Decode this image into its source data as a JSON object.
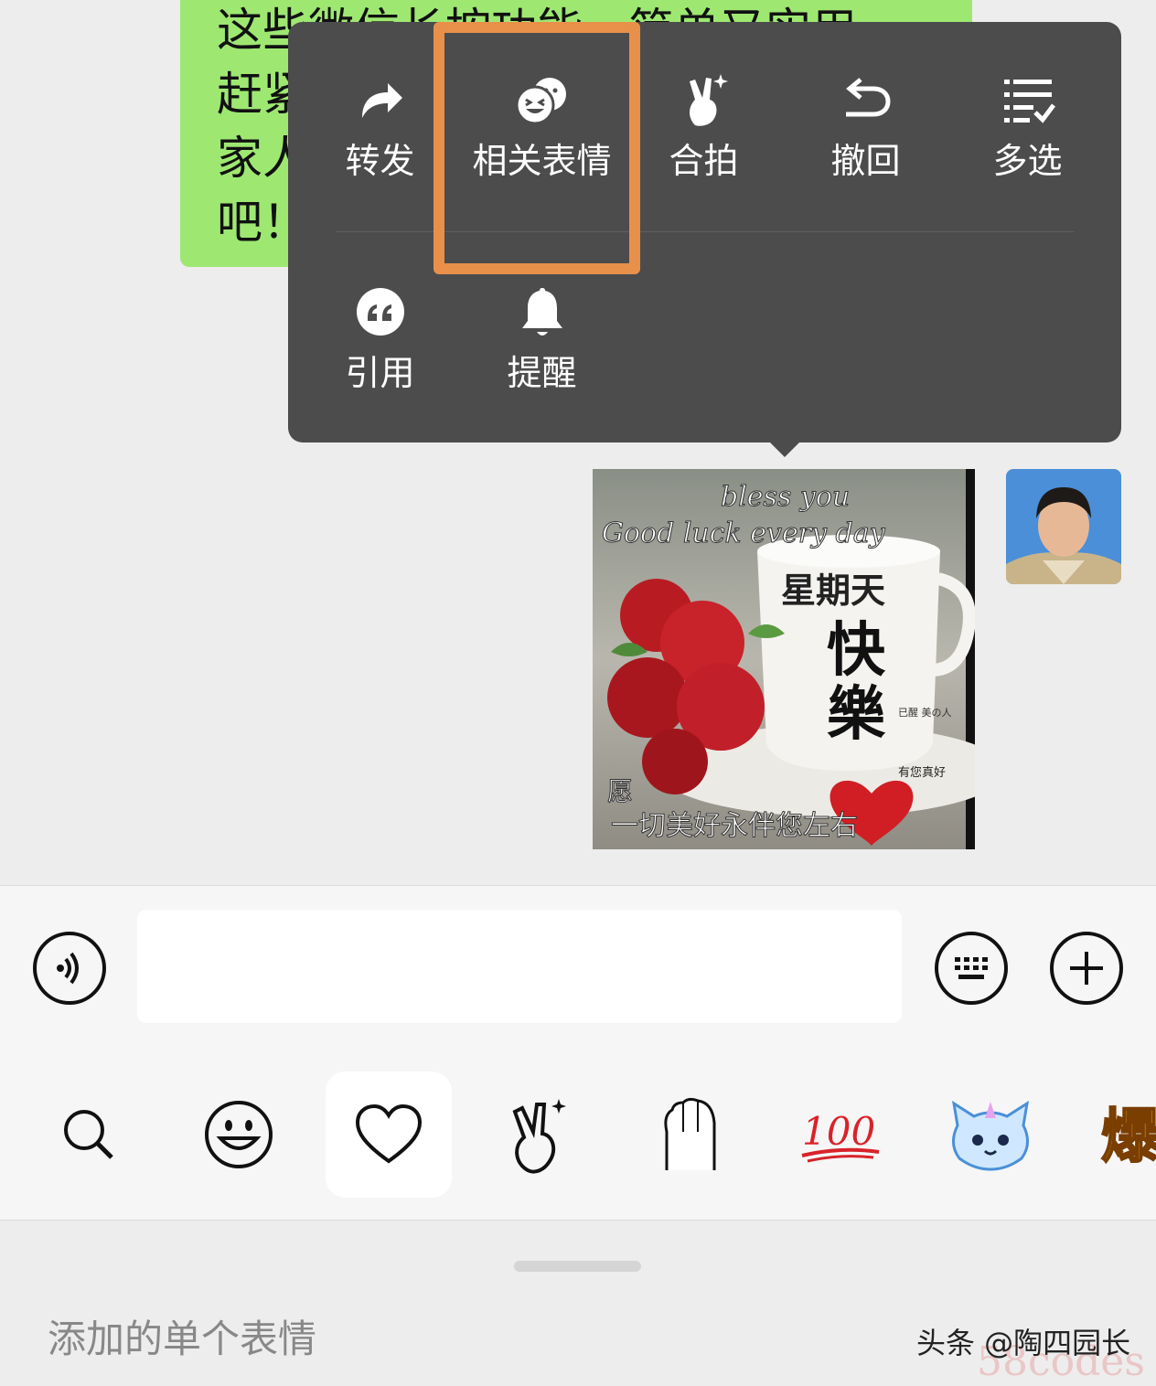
{
  "chat": {
    "message_text": "这些微信长按功能，简单又实用，赶紧\n家人\n吧！"
  },
  "context_menu": {
    "row1": [
      {
        "label": "转发",
        "icon": "forward-icon"
      },
      {
        "label": "相关表情",
        "icon": "related-stickers-icon"
      },
      {
        "label": "合拍",
        "icon": "together-icon"
      },
      {
        "label": "撤回",
        "icon": "recall-icon"
      },
      {
        "label": "多选",
        "icon": "multiselect-icon"
      }
    ],
    "row2": [
      {
        "label": "引用",
        "icon": "quote-icon"
      },
      {
        "label": "提醒",
        "icon": "bell-icon"
      }
    ],
    "highlight_color": "#e8904a"
  },
  "sticker": {
    "line1": "bless you",
    "line2": "Good luck every day",
    "cup_text1": "星期天",
    "cup_text2": "快",
    "cup_text3": "樂",
    "side_text": "已醒 美の人",
    "small_text": "有您真好",
    "wish": "愿",
    "bottom_text": "一切美好永伴您左右"
  },
  "input_bar": {
    "placeholder": ""
  },
  "emoji_tabs": [
    "search-icon",
    "smiley-icon",
    "heart-icon",
    "victory-hand-icon",
    "mitten-icon",
    "hundred-icon",
    "unicorn-cat-icon",
    "burst-text-icon"
  ],
  "emoji_tab_texts": {
    "hundred": "100",
    "burst": "爆"
  },
  "panel": {
    "title": "添加的单个表情",
    "watermark": "头条 @陶四园长",
    "watermark_logo": "58codes"
  }
}
